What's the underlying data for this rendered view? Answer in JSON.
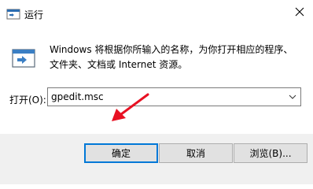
{
  "window": {
    "title": "运行",
    "close_icon": "close-icon",
    "app_icon": "run-icon"
  },
  "content": {
    "description": "Windows 将根据你所输入的名称，为你打开相应的程序、文件夹、文档或 Internet 资源。",
    "open_label": "打开(O):",
    "open_value": "gpedit.msc",
    "annotation_color": "#e81123"
  },
  "buttons": {
    "ok": "确定",
    "cancel": "取消",
    "browse": "浏览(B)..."
  },
  "colors": {
    "accent": "#0078d7",
    "footer_bg": "#f0f0f0"
  }
}
